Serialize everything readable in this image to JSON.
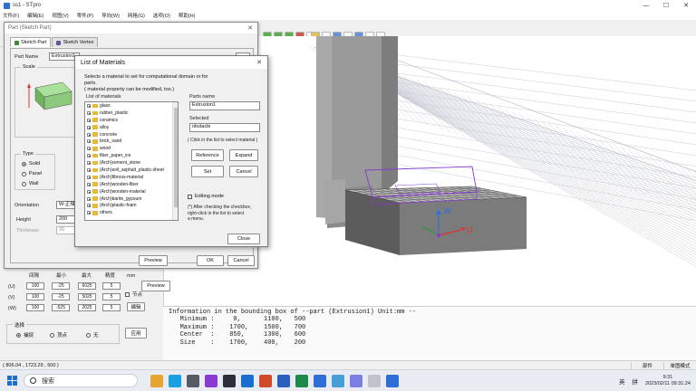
{
  "window": {
    "title": "ss1 - STpro",
    "minimize": "—",
    "maximize": "☐",
    "close": "✕"
  },
  "menu": [
    "文件(F)",
    "编辑(E)",
    "视图(V)",
    "零件(P)",
    "导向(W)",
    "网格(G)",
    "选项(O)",
    "帮助(H)"
  ],
  "part_dialog": {
    "title": "Part (Sketch Part)",
    "close": "✕",
    "tabs": [
      "Sketch Part",
      "Sketch Vertex"
    ],
    "part_name_label": "Part Name",
    "part_name_value": "Extrusion1",
    "scale_label": "Scale",
    "type_label": "Type",
    "type_options": [
      "Solid",
      "Panel",
      "Wall"
    ],
    "orientation_label": "Orientation",
    "orientation_value": "W-正轴",
    "height_label": "Height",
    "height_value": "200",
    "thickness_label": "Thickness",
    "thickness_value": "20",
    "preview_button": "Preview",
    "ok_button": "OK",
    "cancel_button": "Cancel"
  },
  "lower_panel": {
    "headers": [
      "间隔",
      "最小",
      "最大",
      "精度",
      "mm"
    ],
    "rows": [
      {
        "axis": "(U)",
        "values": [
          "100",
          "-25",
          "6025",
          "5"
        ]
      },
      {
        "axis": "(V)",
        "values": [
          "100",
          "-25",
          "5025",
          "5"
        ]
      },
      {
        "axis": "(W)",
        "values": [
          "100",
          "-525",
          "2025",
          "5"
        ]
      }
    ],
    "node_label": "节点",
    "edit_button": "编辑",
    "select_label": "选择",
    "select_options": [
      "捕捉",
      "顶点",
      "无"
    ],
    "apply_button": "应用"
  },
  "materials_dialog": {
    "title": "List of Materials",
    "close": "✕",
    "description": "Selects a material to set for computational domain or for parts.\n( material property can be modified, too.)",
    "list_label": "List of materials",
    "items": [
      "glass",
      "rubber_plastic",
      "ceramics",
      "alloy",
      "concrete",
      "brick_sand",
      "wood",
      "fiber_paper_ice",
      "(Arch)cement_stone",
      "(Arch)soil_asphalt_plastic-sheet",
      "(Arch)fibrous-material",
      "(Arch)wooden-fiber",
      "(Arch)wooden-material",
      "(Arch)barite_gypsum",
      "(Arch)plastic-foam",
      "others"
    ],
    "parts_name_label": "Parts name",
    "parts_name_value": "Extrusion1",
    "selected_label": "Selected",
    "selected_value": "obstacle",
    "click_hint": "( Click in the list to select material )",
    "reference_button": "Reference",
    "expand_button": "Expand",
    "set_button": "Set",
    "cancel_button": "Cancel",
    "editing_mode_label": "Editing mode",
    "editing_note": "(*) After checking the checkbox,\nright-click in the list to select\na menu.",
    "close_button": "Close"
  },
  "viewport": {
    "axis_u": "U",
    "axis_w": "W"
  },
  "info_panel": {
    "lines": [
      "Information in the bounding box of --part (Extrusion1) Unit:mm --",
      "   Minimum :     0,      1100,   500",
      "   Maximum :    1700,    1500,   700",
      "   Center  :    850,     1300,   600",
      "   Size    :    1700,    400,    200"
    ]
  },
  "status_bar": {
    "coordinates": "( 806.04 , 1723.29 , 500 )",
    "cells": [
      "部件",
      "单图模式"
    ]
  },
  "taskbar": {
    "search_placeholder": "搜索",
    "ime_1": "英",
    "ime_2": "拼",
    "time": "9:31",
    "date": "2023/02/11 09:31:24"
  },
  "colors": {
    "accent": "#2d6fd6",
    "folder": "#e8b83a",
    "axis_u": "#e03030",
    "axis_v": "#2f9a2f",
    "axis_w": "#2f6fe0",
    "selection": "#8a3ad0"
  }
}
